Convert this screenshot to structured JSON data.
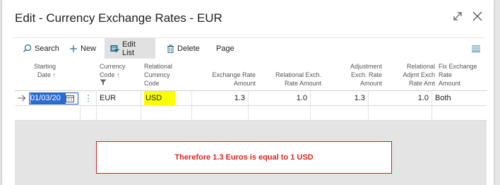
{
  "window": {
    "title": "Edit - Currency Exchange Rates - EUR"
  },
  "toolbar": {
    "search_label": "Search",
    "new_label": "New",
    "edit_list_label": "Edit List",
    "delete_label": "Delete",
    "page_label": "Page"
  },
  "columns": {
    "starting_date": [
      "Starting",
      "Date ↑"
    ],
    "currency_code": [
      "Currency",
      "Code ↑"
    ],
    "relational_currency_code": [
      "Relational",
      "Currency",
      "Code"
    ],
    "exchange_rate_amount": [
      "Exchange Rate",
      "Amount"
    ],
    "relational_exch_rate_amount": [
      "Relational Exch.",
      "Rate Amount"
    ],
    "adjustment_exch_rate_amount": [
      "Adjustment",
      "Exch. Rate",
      "Amount"
    ],
    "relational_adjmt_exch_rate_amt": [
      "Relational",
      "Adjmt Exch",
      "Rate Amt"
    ],
    "fix_exchange_rate_amount": [
      "Fix Exchange",
      "Rate",
      "Amount"
    ]
  },
  "rows": [
    {
      "starting_date": "01/03/20",
      "currency_code": "EUR",
      "relational_currency_code": "USD",
      "exchange_rate_amount": "1.3",
      "relational_exch_rate_amount": "1.0",
      "adjustment_exch_rate_amount": "1.3",
      "relational_adjmt_exch_rate_amt": "1.0",
      "fix_exchange_rate_amount": "Both"
    }
  ],
  "note": {
    "text": "Therefore 1.3 Euros is equal to 1 USD",
    "color": "#e0231f"
  },
  "colors": {
    "highlight": "#fbff00",
    "selection": "#2a6cd0"
  }
}
